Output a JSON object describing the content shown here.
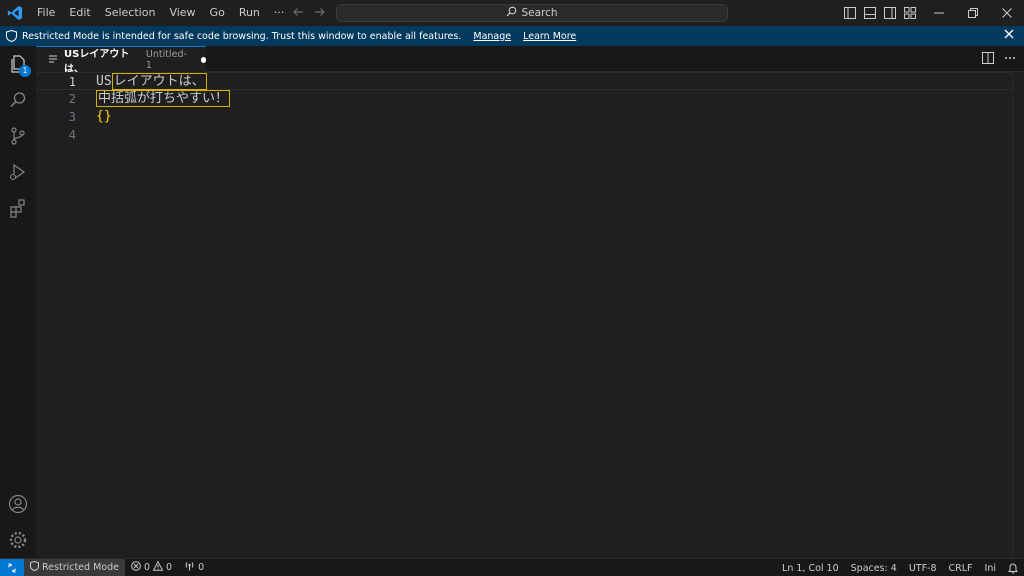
{
  "menu": [
    "File",
    "Edit",
    "Selection",
    "View",
    "Go",
    "Run",
    "···"
  ],
  "search": {
    "label": "Search"
  },
  "banner": {
    "message": "Restricted Mode is intended for safe code browsing. Trust this window to enable all features.",
    "manage": "Manage",
    "learn_more": "Learn More"
  },
  "activity": {
    "explorer_badge": "1"
  },
  "tab": {
    "title": "USレイアウトは、",
    "description": "Untitled-1"
  },
  "editor": {
    "lines": [
      {
        "number": "1",
        "plain": "US",
        "highlighted": "レイアウトは、"
      },
      {
        "number": "2",
        "plain": "",
        "highlighted": "中括弧が打ちやすい！"
      },
      {
        "number": "3",
        "brace": "{}"
      },
      {
        "number": "4"
      }
    ]
  },
  "status": {
    "restricted": "Restricted Mode",
    "errors": "0",
    "warnings": "0",
    "ports": "0",
    "position": "Ln 1, Col 10",
    "spaces": "Spaces: 4",
    "encoding": "UTF-8",
    "eol": "CRLF",
    "language": "Ini"
  },
  "colors": {
    "accent": "#0078d4",
    "banner": "#04395e",
    "highlight_border": "#d7b100",
    "brace": "#ffd700"
  }
}
